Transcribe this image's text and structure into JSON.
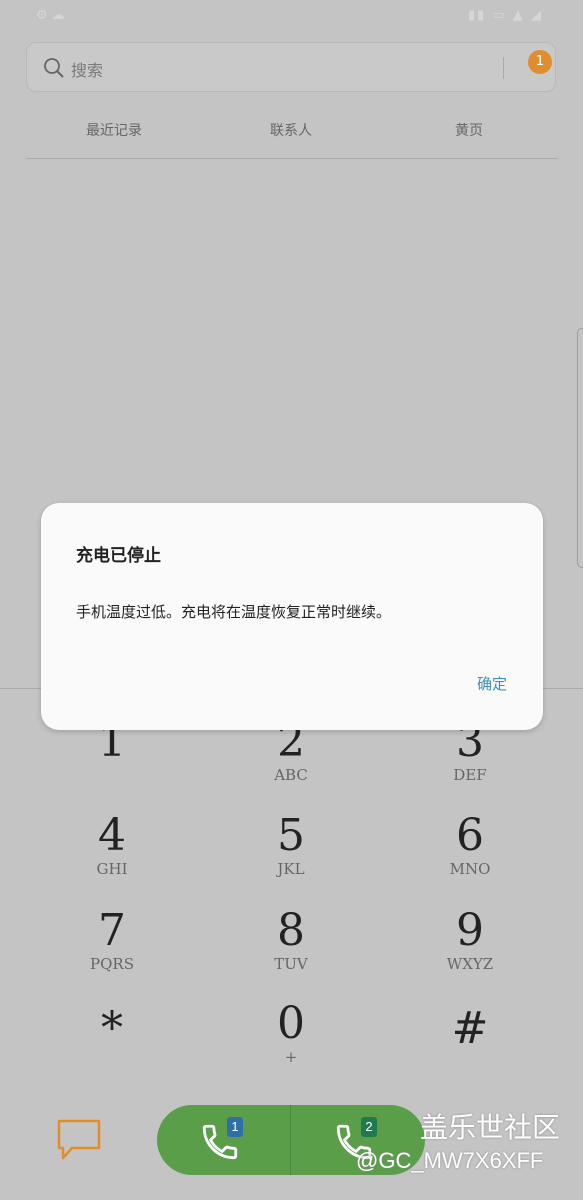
{
  "search": {
    "placeholder": "搜索",
    "badge": "1"
  },
  "tabs": [
    "最近记录",
    "联系人",
    "黄页"
  ],
  "dialog": {
    "title": "充电已停止",
    "message": "手机温度过低。充电将在温度恢复正常时继续。",
    "ok_label": "确定"
  },
  "keypad": [
    {
      "digit": "1",
      "letters": ""
    },
    {
      "digit": "2",
      "letters": "ABC"
    },
    {
      "digit": "3",
      "letters": "DEF"
    },
    {
      "digit": "4",
      "letters": "GHI"
    },
    {
      "digit": "5",
      "letters": "JKL"
    },
    {
      "digit": "6",
      "letters": "MNO"
    },
    {
      "digit": "7",
      "letters": "PQRS"
    },
    {
      "digit": "8",
      "letters": "TUV"
    },
    {
      "digit": "9",
      "letters": "WXYZ"
    },
    {
      "digit": "*",
      "letters": ""
    },
    {
      "digit": "0",
      "letters": "+"
    },
    {
      "digit": "#",
      "letters": ""
    }
  ],
  "call_buttons": [
    {
      "sim": "1",
      "sim_color": "#2f6fa8"
    },
    {
      "sim": "2",
      "sim_color": "#1f7a4f"
    }
  ],
  "colors": {
    "accent_orange": "#e08d2e",
    "call_green": "#5a9e4a",
    "link_blue": "#3b8fb8"
  },
  "watermark": {
    "title": "盖乐世社区",
    "handle": "@GC_MW7X6XFF"
  }
}
